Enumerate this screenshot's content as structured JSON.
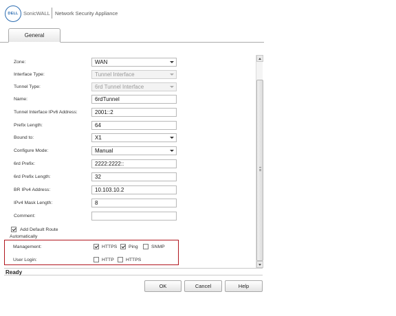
{
  "header": {
    "logo_text": "DELL",
    "brand": "SonicWALL",
    "product": "Network Security Appliance"
  },
  "tabs": [
    {
      "label": "General",
      "active": true
    }
  ],
  "form": {
    "zone": {
      "label": "Zone:",
      "value": "WAN"
    },
    "interface_type": {
      "label": "Interface Type:",
      "value": "Tunnel Interface",
      "disabled": true
    },
    "tunnel_type": {
      "label": "Tunnel Type:",
      "value": "6rd Tunnel Interface",
      "disabled": true
    },
    "name": {
      "label": "Name:",
      "value": "6rdTunnel"
    },
    "tunnel_ipv6": {
      "label": "Tunnel Interface IPv6 Address:",
      "value": "2001::2"
    },
    "prefix_length": {
      "label": "Prefix Length:",
      "value": "64"
    },
    "bound_to": {
      "label": "Bound to:",
      "value": "X1"
    },
    "configure_mode": {
      "label": "Configure Mode:",
      "value": "Manual"
    },
    "sixrd_prefix": {
      "label": "6rd Prefix:",
      "value": "2222:2222::"
    },
    "sixrd_prefix_length": {
      "label": "6rd Prefix Length:",
      "value": "32"
    },
    "br_ipv4": {
      "label": "BR IPv4 Address:",
      "value": "10.103.10.2"
    },
    "ipv4_mask_length": {
      "label": "IPv4 Mask Length:",
      "value": "8"
    },
    "comment": {
      "label": "Comment:",
      "value": ""
    },
    "add_default_route": {
      "label_line1": "Add Default Route",
      "label_line2": "Automatically",
      "checked": true
    }
  },
  "management": {
    "label": "Management:",
    "options": [
      {
        "label": "HTTPS",
        "checked": true
      },
      {
        "label": "Ping",
        "checked": true
      },
      {
        "label": "SNMP",
        "checked": false
      }
    ]
  },
  "user_login": {
    "label": "User Login:",
    "options": [
      {
        "label": "HTTP",
        "checked": false
      },
      {
        "label": "HTTPS",
        "checked": false
      }
    ]
  },
  "status": {
    "text": "Ready"
  },
  "buttons": {
    "ok": "OK",
    "cancel": "Cancel",
    "help": "Help"
  },
  "colors": {
    "highlight_border": "#b0141c",
    "logo_blue": "#2a6bb0"
  }
}
